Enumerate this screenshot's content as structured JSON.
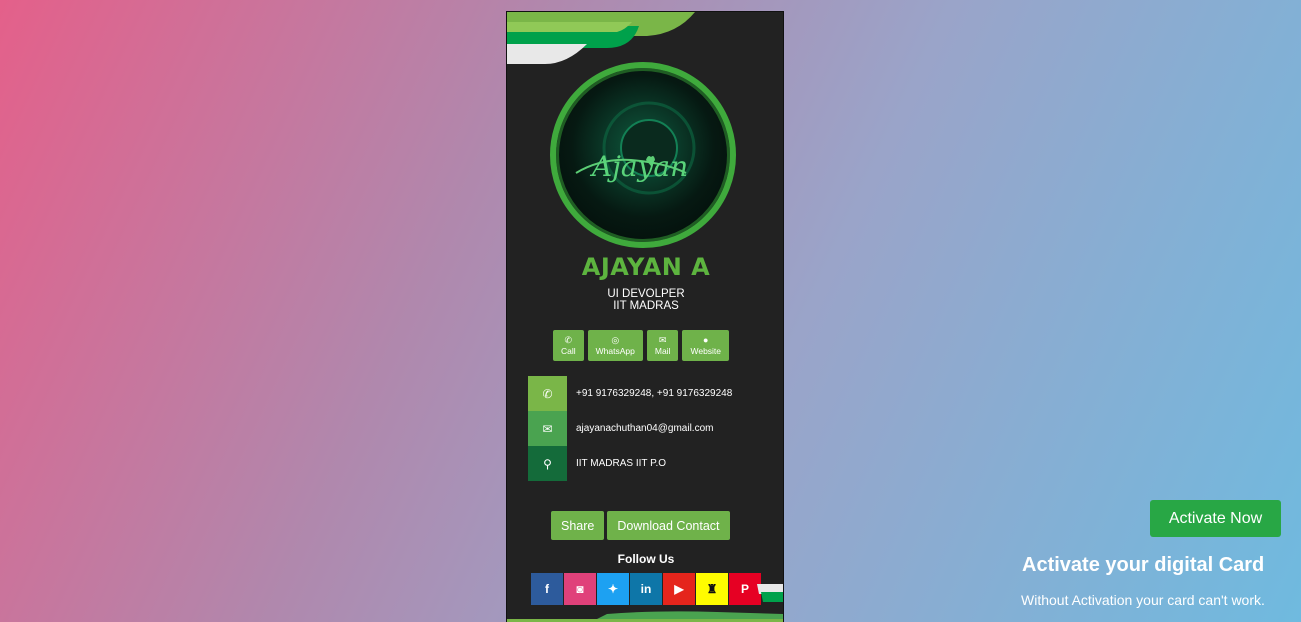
{
  "card": {
    "avatar_text": "Ajayan",
    "name": "AJAYAN A",
    "role": "UI DEVOLPER",
    "organization": "IIT MADRAS",
    "quick_actions": [
      {
        "label": "Call",
        "icon": "phone-icon",
        "glyph": "✆"
      },
      {
        "label": "WhatsApp",
        "icon": "whatsapp-icon",
        "glyph": "◎"
      },
      {
        "label": "Mail",
        "icon": "mail-icon",
        "glyph": "✉"
      },
      {
        "label": "Website",
        "icon": "globe-icon",
        "glyph": "●"
      }
    ],
    "contacts": [
      {
        "icon": "phone-icon",
        "glyph": "✆",
        "text": "+91 9176329248, +91 9176329248",
        "color": "#7ab648"
      },
      {
        "icon": "mail-icon",
        "glyph": "✉",
        "text": "ajayanachuthan04@gmail.com",
        "color": "#4aa350"
      },
      {
        "icon": "location-pin-icon",
        "glyph": "⚲",
        "text": "IIT MADRAS IIT P.O",
        "color": "#146b3a"
      }
    ],
    "share_label": "Share",
    "download_label": "Download Contact",
    "follow_label": "Follow Us",
    "social": [
      {
        "name": "facebook-icon",
        "glyph": "f",
        "color": "#2d5b9c"
      },
      {
        "name": "instagram-icon",
        "glyph": "◙",
        "color": "#e0417a"
      },
      {
        "name": "twitter-icon",
        "glyph": "✦",
        "color": "#1da1f2"
      },
      {
        "name": "linkedin-icon",
        "glyph": "in",
        "color": "#0e76a8"
      },
      {
        "name": "youtube-icon",
        "glyph": "▶",
        "color": "#e5251c"
      },
      {
        "name": "snapchat-icon",
        "glyph": "♜",
        "color": "#fffc00"
      },
      {
        "name": "pinterest-icon",
        "glyph": "P",
        "color": "#e60023"
      }
    ]
  },
  "activation": {
    "button_label": "Activate Now",
    "title": "Activate your digital Card",
    "note": "Without Activation your card can't work."
  },
  "colors": {
    "accent_green": "#6fb24a",
    "name_green": "#5db43f",
    "card_bg": "#222222",
    "activate_green": "#28a745"
  }
}
